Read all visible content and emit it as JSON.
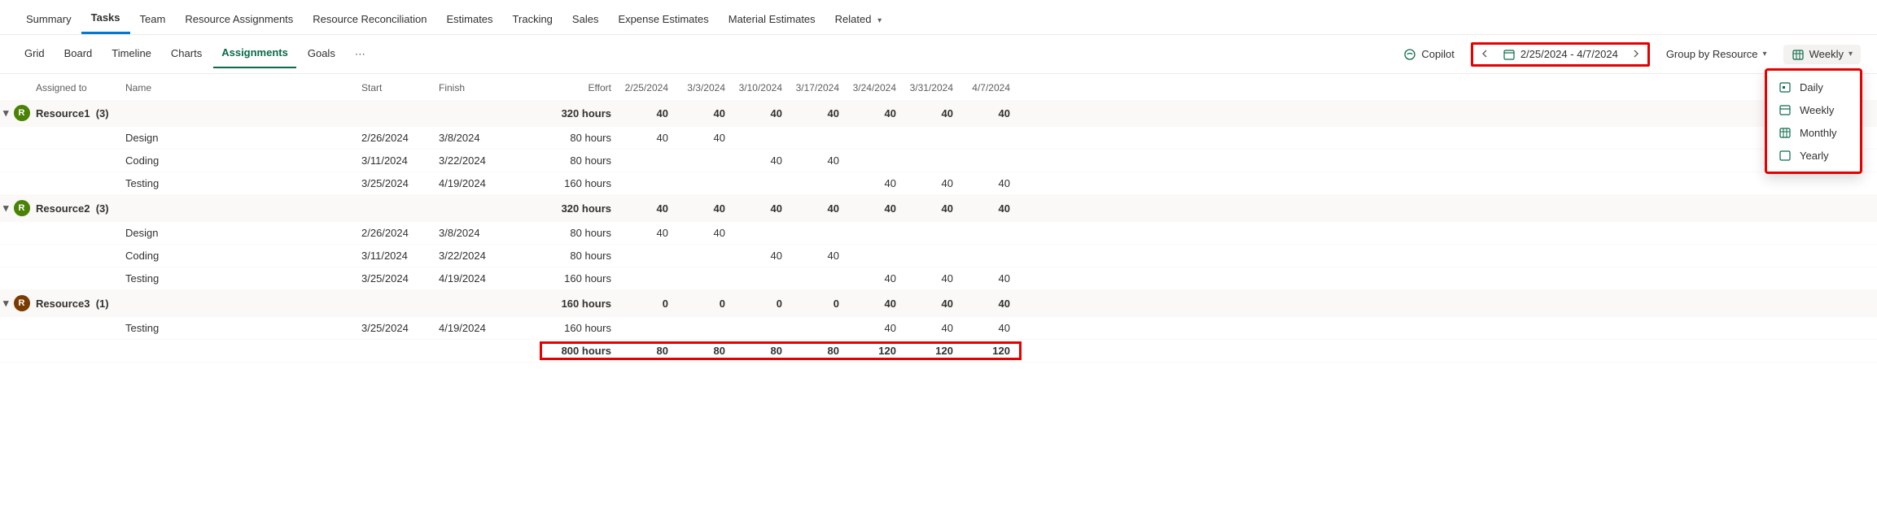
{
  "top_tabs": {
    "summary": "Summary",
    "tasks": "Tasks",
    "team": "Team",
    "ra": "Resource Assignments",
    "rr": "Resource Reconciliation",
    "est": "Estimates",
    "track": "Tracking",
    "sales": "Sales",
    "ee": "Expense Estimates",
    "me": "Material Estimates",
    "related": "Related"
  },
  "sub_tabs": {
    "grid": "Grid",
    "board": "Board",
    "timeline": "Timeline",
    "charts": "Charts",
    "assignments": "Assignments",
    "goals": "Goals"
  },
  "controls": {
    "copilot": "Copilot",
    "date_range": "2/25/2024 - 4/7/2024",
    "group_by": "Group by Resource",
    "timescale": "Weekly"
  },
  "dropdown": {
    "daily": "Daily",
    "weekly": "Weekly",
    "monthly": "Monthly",
    "yearly": "Yearly"
  },
  "columns": {
    "assigned": "Assigned to",
    "name": "Name",
    "start": "Start",
    "finish": "Finish",
    "effort": "Effort",
    "d1": "2/25/2024",
    "d2": "3/3/2024",
    "d3": "3/10/2024",
    "d4": "3/17/2024",
    "d5": "3/24/2024",
    "d6": "3/31/2024",
    "d7": "4/7/2024"
  },
  "groups": [
    {
      "name": "Resource1",
      "count": "(3)",
      "avatar_class": "",
      "effort": "320 hours",
      "cells": [
        "40",
        "40",
        "40",
        "40",
        "40",
        "40",
        "40"
      ],
      "rows": [
        {
          "name": "Design",
          "start": "2/26/2024",
          "finish": "3/8/2024",
          "effort": "80 hours",
          "cells": [
            "40",
            "40",
            "",
            "",
            "",
            "",
            ""
          ]
        },
        {
          "name": "Coding",
          "start": "3/11/2024",
          "finish": "3/22/2024",
          "effort": "80 hours",
          "cells": [
            "",
            "",
            "40",
            "40",
            "",
            "",
            ""
          ]
        },
        {
          "name": "Testing",
          "start": "3/25/2024",
          "finish": "4/19/2024",
          "effort": "160 hours",
          "cells": [
            "",
            "",
            "",
            "",
            "40",
            "40",
            "40"
          ]
        }
      ]
    },
    {
      "name": "Resource2",
      "count": "(3)",
      "avatar_class": "",
      "effort": "320 hours",
      "cells": [
        "40",
        "40",
        "40",
        "40",
        "40",
        "40",
        "40"
      ],
      "rows": [
        {
          "name": "Design",
          "start": "2/26/2024",
          "finish": "3/8/2024",
          "effort": "80 hours",
          "cells": [
            "40",
            "40",
            "",
            "",
            "",
            "",
            ""
          ]
        },
        {
          "name": "Coding",
          "start": "3/11/2024",
          "finish": "3/22/2024",
          "effort": "80 hours",
          "cells": [
            "",
            "",
            "40",
            "40",
            "",
            "",
            ""
          ]
        },
        {
          "name": "Testing",
          "start": "3/25/2024",
          "finish": "4/19/2024",
          "effort": "160 hours",
          "cells": [
            "",
            "",
            "",
            "",
            "40",
            "40",
            "40"
          ]
        }
      ]
    },
    {
      "name": "Resource3",
      "count": "(1)",
      "avatar_class": "r3",
      "effort": "160 hours",
      "cells": [
        "0",
        "0",
        "0",
        "0",
        "40",
        "40",
        "40"
      ],
      "rows": [
        {
          "name": "Testing",
          "start": "3/25/2024",
          "finish": "4/19/2024",
          "effort": "160 hours",
          "cells": [
            "",
            "",
            "",
            "",
            "40",
            "40",
            "40"
          ]
        }
      ]
    }
  ],
  "totals": {
    "effort": "800 hours",
    "cells": [
      "80",
      "80",
      "80",
      "80",
      "120",
      "120",
      "120"
    ]
  },
  "avatar_letter": "R"
}
